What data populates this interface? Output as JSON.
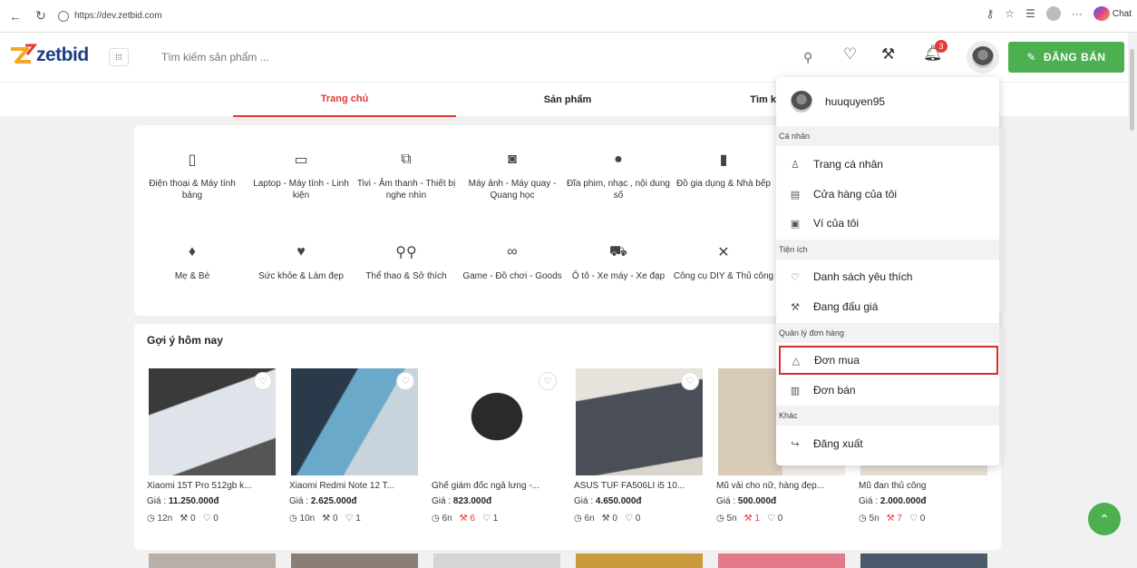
{
  "browser": {
    "url": "https://dev.zetbid.com",
    "chat_label": "Chat"
  },
  "header": {
    "logo_text": "zetbid",
    "search_placeholder": "Tìm kiếm sản phẩm ...",
    "notification_count": "3",
    "sell_button": "ĐĂNG BÁN"
  },
  "tabs": [
    {
      "label": "Trang chủ",
      "active": true
    },
    {
      "label": "Sản phẩm",
      "active": false
    },
    {
      "label": "Tìm k",
      "active": false
    }
  ],
  "categories": [
    {
      "icon": "phone-icon",
      "label": "Điện thoại & Máy tính bảng"
    },
    {
      "icon": "laptop-icon",
      "label": "Laptop - Máy tính - Linh kiện"
    },
    {
      "icon": "tv-icon",
      "label": "Tivi - Âm thanh - Thiết bị nghe nhìn"
    },
    {
      "icon": "camera-icon",
      "label": "Máy ảnh - Máy quay - Quang học"
    },
    {
      "icon": "disc-icon",
      "label": "Đĩa phim, nhạc , nội dung số"
    },
    {
      "icon": "appliance-icon",
      "label": "Đồ gia dụng & Nhà bếp"
    },
    {
      "icon": "baby-icon",
      "label": "Mẹ & Bé"
    },
    {
      "icon": "heart-health-icon",
      "label": "Sức khỏe & Làm đẹp"
    },
    {
      "icon": "bicycle-icon",
      "label": "Thể thao & Sở thích"
    },
    {
      "icon": "gamepad-icon",
      "label": "Game - Đồ chơi - Goods"
    },
    {
      "icon": "car-icon",
      "label": "Ô tô - Xe máy - Xe đạp"
    },
    {
      "icon": "tools-icon",
      "label": "Công cụ DIY & Thủ công"
    }
  ],
  "suggestions": {
    "title": "Gợi ý hôm nay",
    "products": [
      {
        "name": "Xiaomi 15T Pro 512gb k...",
        "price_label": "Giá : ",
        "price": "11.250.000đ",
        "time": "12n",
        "bids": "0",
        "likes": "0",
        "bids_red": false
      },
      {
        "name": "Xiaomi Redmi Note 12 T...",
        "price_label": "Giá : ",
        "price": "2.625.000đ",
        "time": "10n",
        "bids": "0",
        "likes": "1",
        "bids_red": false
      },
      {
        "name": "Ghế giám đốc ngả lưng -...",
        "price_label": "Giá : ",
        "price": "823.000đ",
        "time": "6n",
        "bids": "6",
        "likes": "1",
        "bids_red": true
      },
      {
        "name": "ASUS TUF FA506LI i5 10...",
        "price_label": "Giá : ",
        "price": "4.650.000đ",
        "time": "6n",
        "bids": "0",
        "likes": "0",
        "bids_red": false
      },
      {
        "name": "Mũ vải cho nữ, hàng đẹp...",
        "price_label": "Giá : ",
        "price": "500.000đ",
        "time": "5n",
        "bids": "1",
        "likes": "0",
        "bids_red": true
      },
      {
        "name": "Mũ đan thủ công",
        "price_label": "Giá : ",
        "price": "2.000.000đ",
        "time": "5n",
        "bids": "7",
        "likes": "0",
        "bids_red": true
      }
    ]
  },
  "dropdown": {
    "username": "huuquyen95",
    "sections": [
      {
        "title": "Cá nhân",
        "items": [
          {
            "icon": "user-icon",
            "label": "Trang cá nhân"
          },
          {
            "icon": "store-icon",
            "label": "Cửa hàng của tôi"
          },
          {
            "icon": "wallet-icon",
            "label": "Ví của tôi"
          }
        ]
      },
      {
        "title": "Tiện ích",
        "items": [
          {
            "icon": "heart-icon",
            "label": "Danh sách yêu thích"
          },
          {
            "icon": "gavel-icon",
            "label": "Đang đấu giá"
          }
        ]
      },
      {
        "title": "Quản lý đơn hàng",
        "items": [
          {
            "icon": "shopping-bag-icon",
            "label": "Đơn mua"
          },
          {
            "icon": "receipt-icon",
            "label": "Đơn bán"
          }
        ]
      },
      {
        "title": "Khác",
        "items": [
          {
            "icon": "logout-icon",
            "label": "Đăng xuất"
          }
        ]
      }
    ]
  },
  "colors": {
    "accent_red": "#e53935",
    "brand_green": "#4caf50",
    "logo_blue": "#1c3e8a",
    "logo_orange": "#f5a623"
  }
}
